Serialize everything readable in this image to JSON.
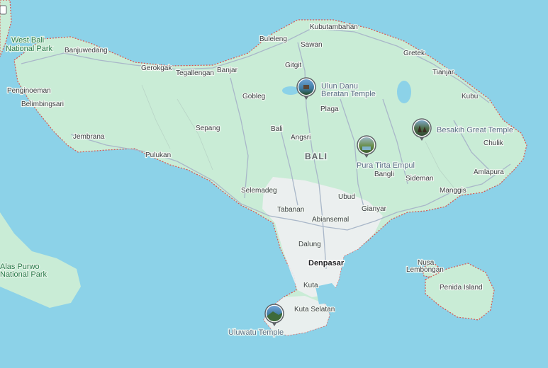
{
  "places": {
    "west_bali": {
      "line1": "West Bali",
      "line2": "National Park"
    },
    "alas_purwo": {
      "line1": "Alas Purwo",
      "line2": "National Park"
    },
    "towns": [
      {
        "name": "Buleleng"
      },
      {
        "name": "Kubutambahan"
      },
      {
        "name": "Banjuwedang"
      },
      {
        "name": "Sawan"
      },
      {
        "name": "Gretek"
      },
      {
        "name": "Gerokgak"
      },
      {
        "name": "Tegallengan"
      },
      {
        "name": "Banjar"
      },
      {
        "name": "Gitgit"
      },
      {
        "name": "Tianjar"
      },
      {
        "name": "Penginoeman"
      },
      {
        "name": "Gobleg"
      },
      {
        "name": "Kubu"
      },
      {
        "name": "Belimbingsari"
      },
      {
        "name": "Plaga"
      },
      {
        "name": "Sepang"
      },
      {
        "name": "Bali"
      },
      {
        "name": "Jembrana"
      },
      {
        "name": "Angsri"
      },
      {
        "name": "Chulik"
      },
      {
        "name": "Pulukan"
      },
      {
        "name": "Bangli"
      },
      {
        "name": "Amlapura"
      },
      {
        "name": "Sideman"
      },
      {
        "name": "Selemadeg"
      },
      {
        "name": "Manggis"
      },
      {
        "name": "Ubud"
      },
      {
        "name": "Tabanan"
      },
      {
        "name": "Gianyar"
      },
      {
        "name": "Abiansemal"
      },
      {
        "name": "Dalung"
      },
      {
        "name": "Nusa"
      },
      {
        "name": "Lembongan"
      },
      {
        "name": "Kuta"
      },
      {
        "name": "Penida Island"
      },
      {
        "name": "Kuta Selatan"
      }
    ],
    "region": "BALI",
    "capital": "Denpasar"
  },
  "pois": [
    {
      "line1": "Ulun Danu",
      "line2": "Beratan Temple",
      "icon": "temple-photo-icon"
    },
    {
      "line1": "Pura Tirta Empul",
      "icon": "temple-photo-icon"
    },
    {
      "line1": "Besakih Great Temple",
      "icon": "temple-photo-icon"
    },
    {
      "line1": "Uluwatu Temple",
      "icon": "temple-photo-icon"
    }
  ],
  "colors": {
    "sea": "#8cd2e8",
    "land": "#c9ecd6",
    "urban": "#eef0f2",
    "coast_dash": "#d9534f",
    "pin_border": "#5f6368"
  }
}
